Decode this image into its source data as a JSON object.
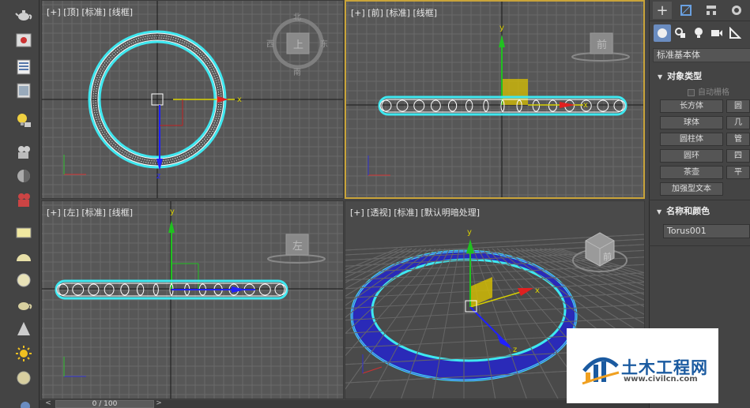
{
  "viewports": {
    "top": {
      "label": "[+] [顶] [标准] [线框]",
      "cube_label": "上",
      "compass": [
        "北",
        "西",
        "东",
        "南"
      ]
    },
    "front": {
      "label": "[+] [前] [标准] [线框]",
      "cube_label": "前"
    },
    "left": {
      "label": "[+] [左] [标准] [线框]",
      "cube_label": "左"
    },
    "persp": {
      "label": "[+] [透视] [标准] [默认明暗处理]",
      "cube_label": "前"
    }
  },
  "axes": {
    "x": "x",
    "y": "y",
    "z": "z"
  },
  "command_panel": {
    "tabs": [
      "create",
      "modify",
      "hierarchy",
      "motion"
    ],
    "subtabs": [
      "geometry",
      "shapes",
      "lights",
      "cameras",
      "helpers"
    ],
    "category_dropdown": "标准基本体",
    "object_type": {
      "title": "对象类型",
      "autogrid_label": "自动栅格",
      "buttons": [
        "长方体",
        "圆",
        "球体",
        "几",
        "圆柱体",
        "管",
        "圆环",
        "四",
        "茶壶",
        "平",
        "加强型文本"
      ]
    },
    "name_color": {
      "title": "名称和颜色",
      "name_value": "Torus001"
    }
  },
  "time_slider": {
    "value": "0 / 100",
    "prev": "<",
    "next": ">"
  },
  "watermark": {
    "brand": "土木工程网",
    "url": "www.civilcn.com"
  },
  "colors": {
    "torus_outline": "#3ee8f0",
    "torus_fill": "#2a2ab8",
    "active_border": "#c9a43a",
    "viewport_bg": "#575757",
    "grid": "#6a6a6a",
    "grid_main": "#1a1a1a"
  }
}
